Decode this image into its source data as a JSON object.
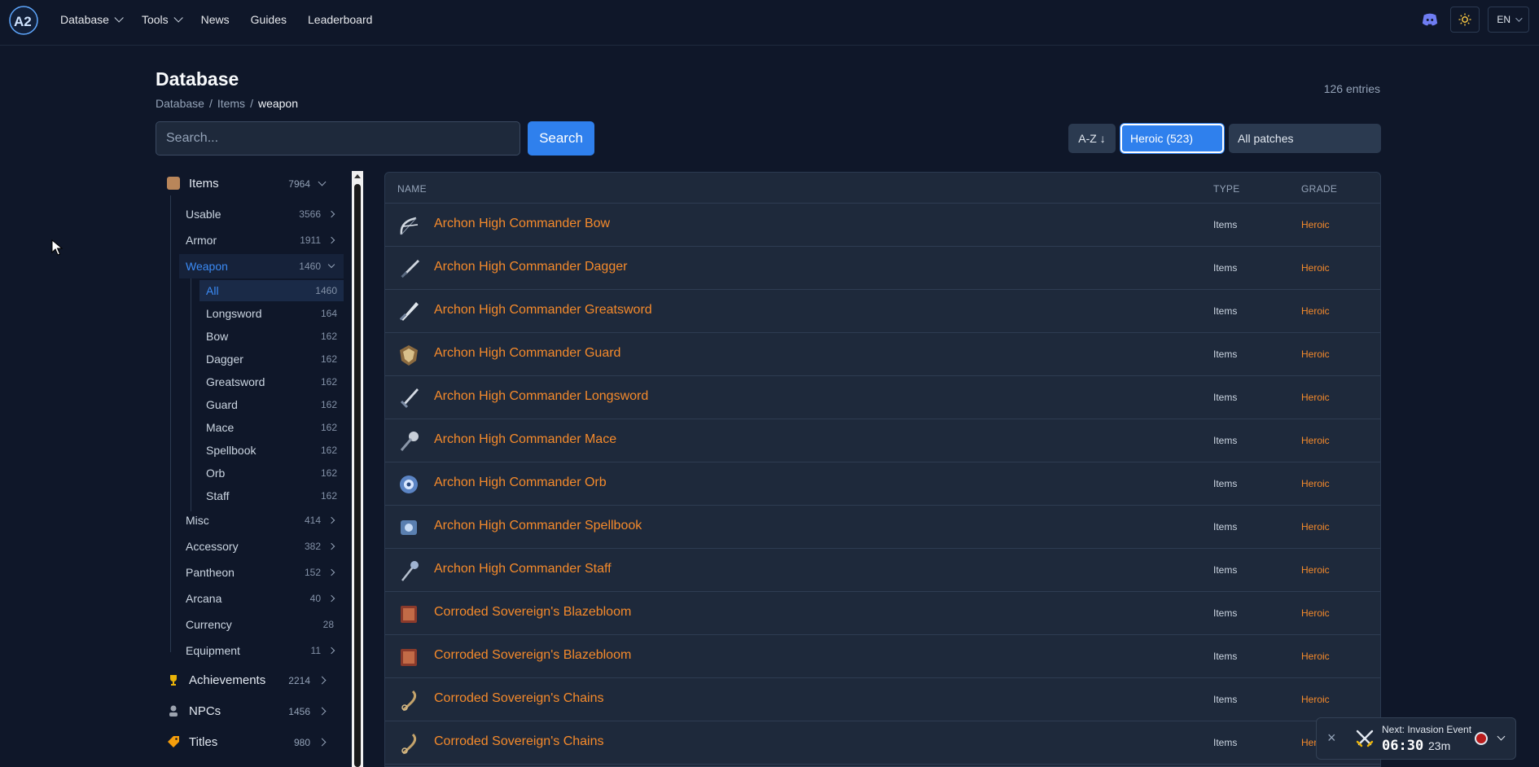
{
  "nav": {
    "items": [
      {
        "label": "Database",
        "dropdown": true
      },
      {
        "label": "Tools",
        "dropdown": true
      },
      {
        "label": "News",
        "dropdown": false
      },
      {
        "label": "Guides",
        "dropdown": false
      },
      {
        "label": "Leaderboard",
        "dropdown": false
      }
    ],
    "lang": "EN"
  },
  "header": {
    "title": "Database",
    "breadcrumb": [
      "Database",
      "Items",
      "weapon"
    ],
    "entries": "126 entries"
  },
  "search": {
    "placeholder": "Search...",
    "button": "Search"
  },
  "filters": {
    "sort": "A-Z ↓",
    "grade": "Heroic (523)",
    "patch": "All patches"
  },
  "sidebar": {
    "categories": [
      {
        "label": "Items",
        "count": "7964",
        "icon": "box-icon",
        "color": "#c08a5a"
      },
      {
        "label": "Achievements",
        "count": "2214",
        "icon": "trophy-icon",
        "color": "#eab308"
      },
      {
        "label": "NPCs",
        "count": "1456",
        "icon": "npc-icon",
        "color": "#a3a3a3"
      },
      {
        "label": "Titles",
        "count": "980",
        "icon": "tag-icon",
        "color": "#f59e0b"
      }
    ],
    "subs": [
      {
        "label": "Usable",
        "count": "3566"
      },
      {
        "label": "Armor",
        "count": "1911"
      },
      {
        "label": "Weapon",
        "count": "1460"
      },
      {
        "label": "Misc",
        "count": "414"
      },
      {
        "label": "Accessory",
        "count": "382"
      },
      {
        "label": "Pantheon",
        "count": "152"
      },
      {
        "label": "Arcana",
        "count": "40"
      },
      {
        "label": "Currency",
        "count": "28"
      },
      {
        "label": "Equipment",
        "count": "11"
      }
    ],
    "leaves": [
      {
        "label": "All",
        "count": "1460"
      },
      {
        "label": "Longsword",
        "count": "164"
      },
      {
        "label": "Bow",
        "count": "162"
      },
      {
        "label": "Dagger",
        "count": "162"
      },
      {
        "label": "Greatsword",
        "count": "162"
      },
      {
        "label": "Guard",
        "count": "162"
      },
      {
        "label": "Mace",
        "count": "162"
      },
      {
        "label": "Spellbook",
        "count": "162"
      },
      {
        "label": "Orb",
        "count": "162"
      },
      {
        "label": "Staff",
        "count": "162"
      }
    ]
  },
  "table": {
    "headers": {
      "name": "NAME",
      "type": "TYPE",
      "grade": "GRADE"
    },
    "rows": [
      {
        "name": "Archon High Commander Bow",
        "type": "Items",
        "grade": "Heroic",
        "icon": "bow-icon"
      },
      {
        "name": "Archon High Commander Dagger",
        "type": "Items",
        "grade": "Heroic",
        "icon": "dagger-icon"
      },
      {
        "name": "Archon High Commander Greatsword",
        "type": "Items",
        "grade": "Heroic",
        "icon": "greatsword-icon"
      },
      {
        "name": "Archon High Commander Guard",
        "type": "Items",
        "grade": "Heroic",
        "icon": "guard-icon"
      },
      {
        "name": "Archon High Commander Longsword",
        "type": "Items",
        "grade": "Heroic",
        "icon": "longsword-icon"
      },
      {
        "name": "Archon High Commander Mace",
        "type": "Items",
        "grade": "Heroic",
        "icon": "mace-icon"
      },
      {
        "name": "Archon High Commander Orb",
        "type": "Items",
        "grade": "Heroic",
        "icon": "orb-icon"
      },
      {
        "name": "Archon High Commander Spellbook",
        "type": "Items",
        "grade": "Heroic",
        "icon": "spellbook-icon"
      },
      {
        "name": "Archon High Commander Staff",
        "type": "Items",
        "grade": "Heroic",
        "icon": "staff-icon"
      },
      {
        "name": "Corroded Sovereign's Blazebloom",
        "type": "Items",
        "grade": "Heroic",
        "icon": "book-icon"
      },
      {
        "name": "Corroded Sovereign's Blazebloom",
        "type": "Items",
        "grade": "Heroic",
        "icon": "book-icon"
      },
      {
        "name": "Corroded Sovereign's Chains",
        "type": "Items",
        "grade": "Heroic",
        "icon": "chains-icon"
      },
      {
        "name": "Corroded Sovereign's Chains",
        "type": "Items",
        "grade": "Heroic",
        "icon": "chains-icon"
      }
    ]
  },
  "toast": {
    "label": "Next: Invasion Event",
    "time": "06:30",
    "minutes": "23m"
  },
  "colors": {
    "accent": "#2f80ed",
    "heroic": "#f58a2b",
    "background": "#0f1729"
  }
}
